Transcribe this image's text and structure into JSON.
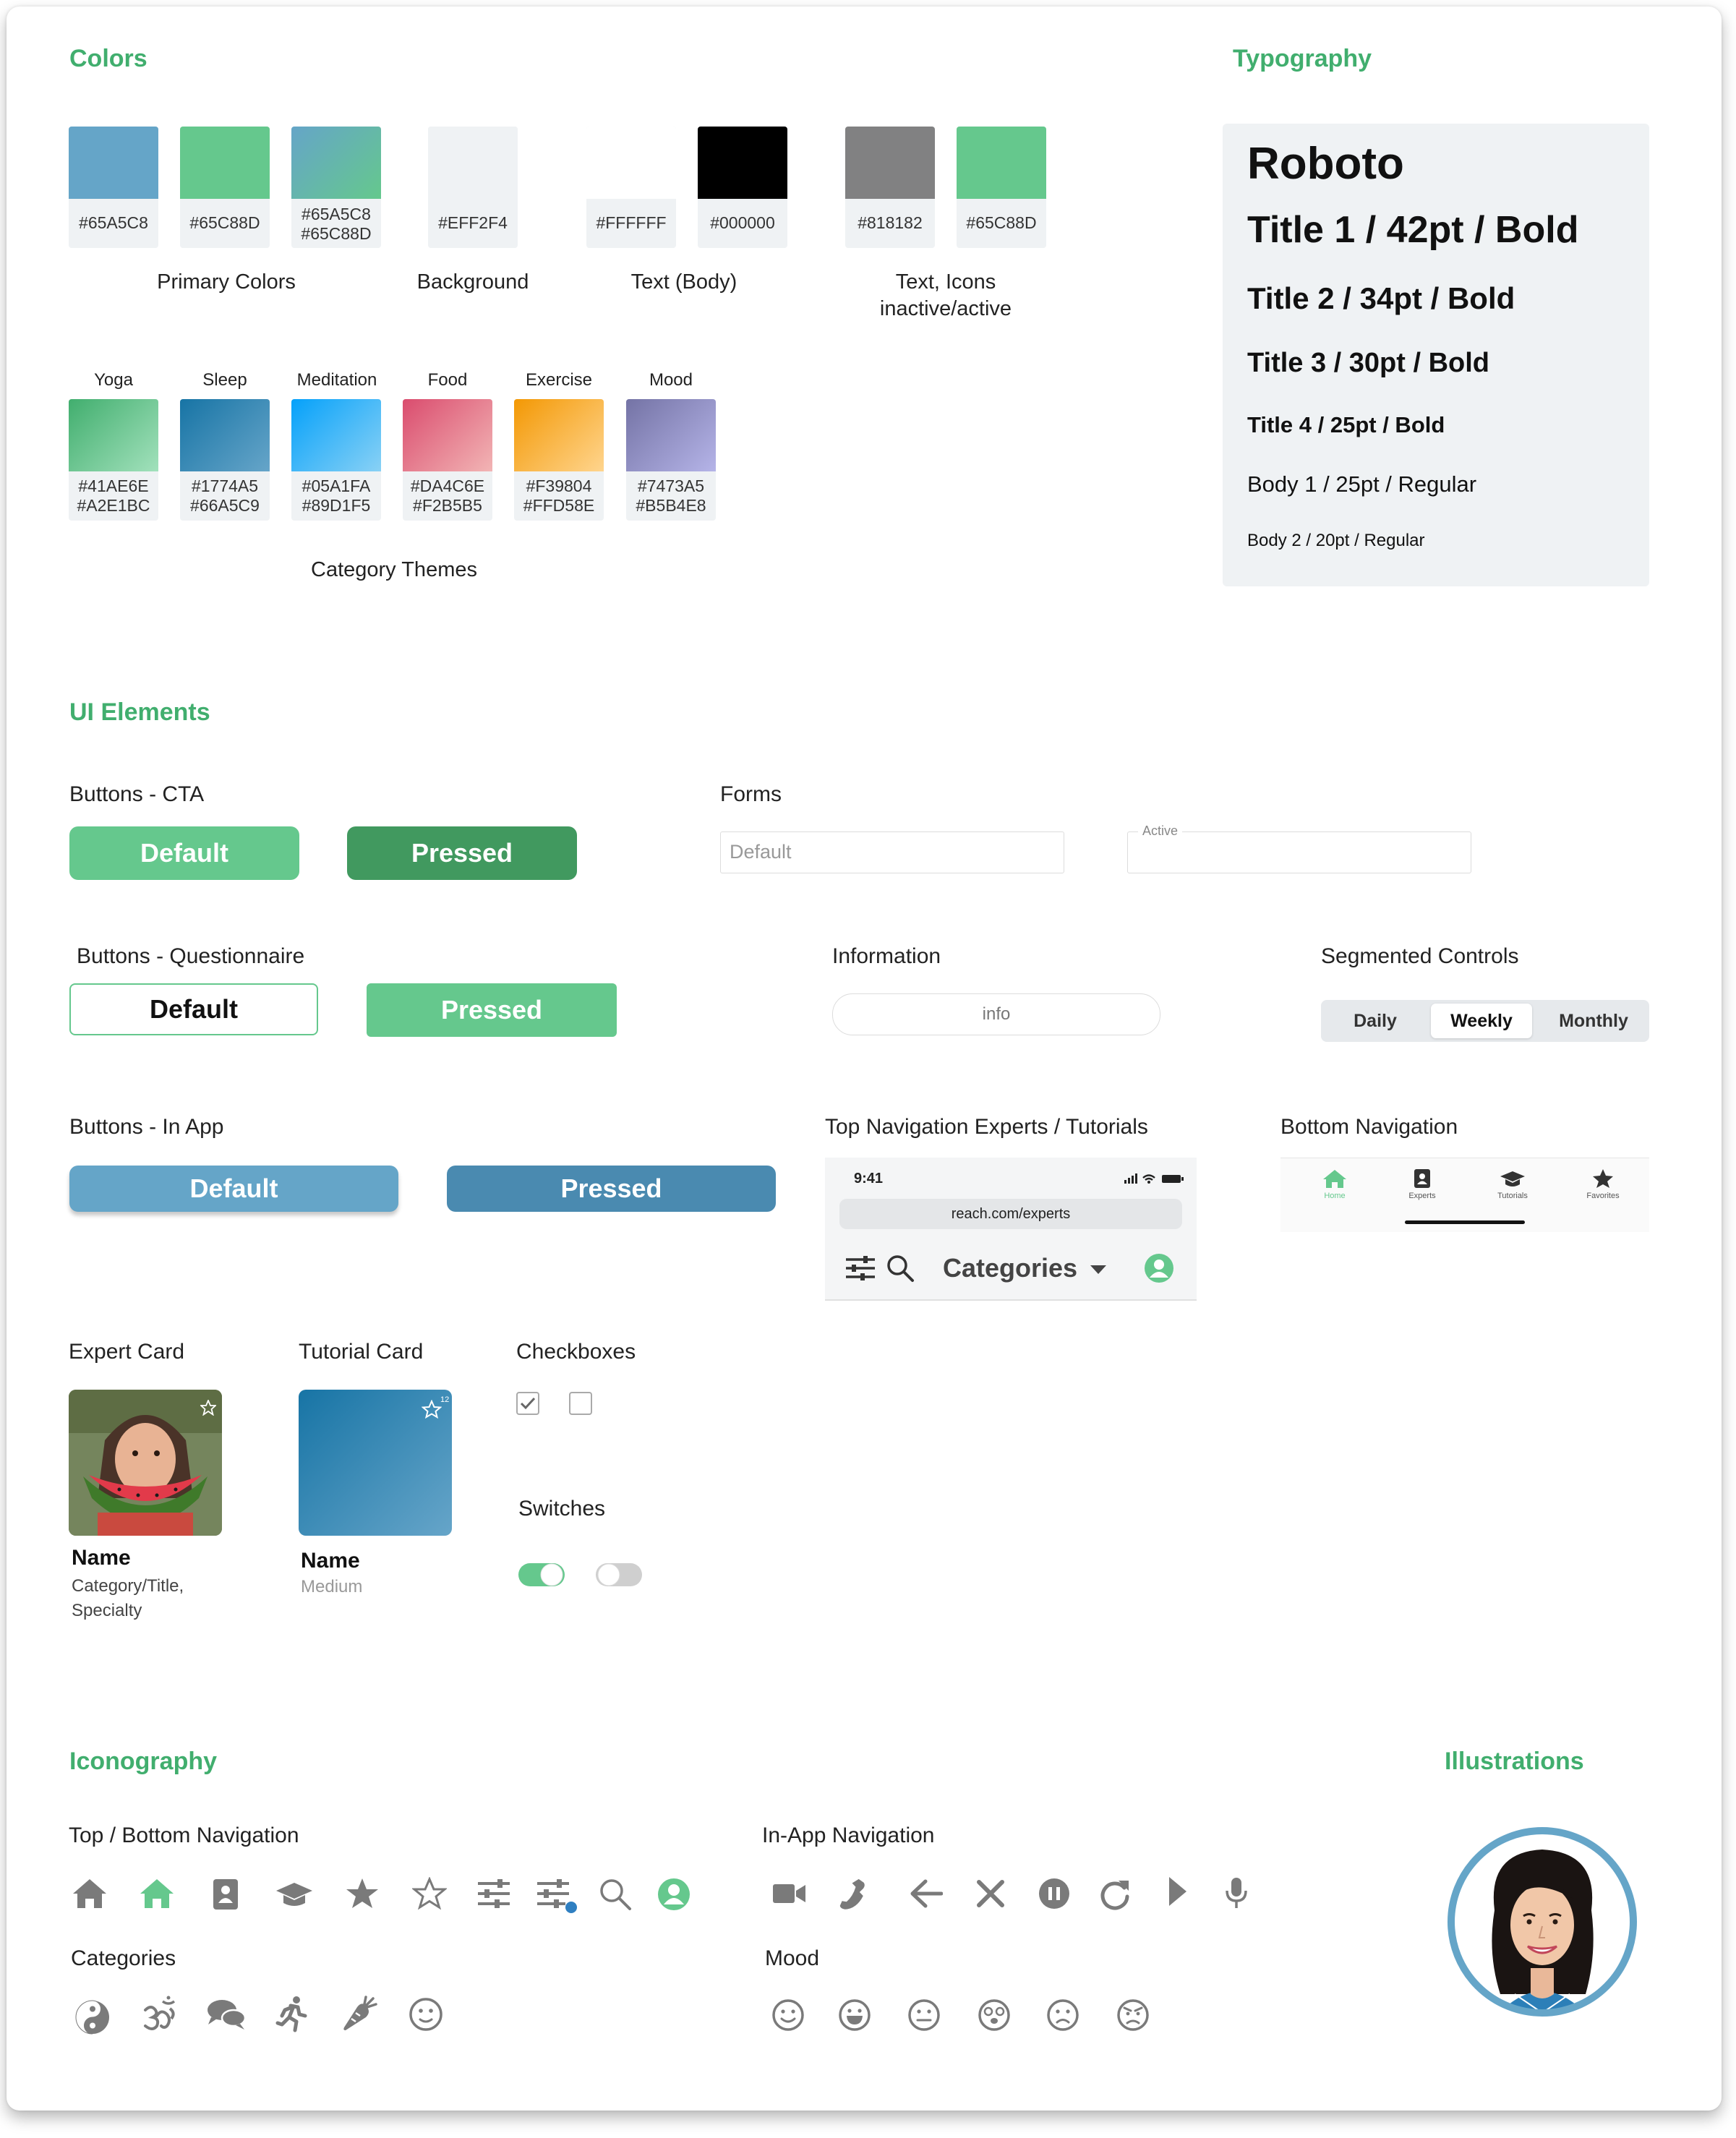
{
  "colors": {
    "title": "Colors",
    "swatches": [
      {
        "hex": "#65A5C8",
        "fill": "#65A5C8"
      },
      {
        "hex": "#65C88D",
        "fill": "#65C88D"
      },
      {
        "hex1": "#65A5C8",
        "hex2": "#65C88D"
      },
      {
        "hex": "#EFF2F4",
        "fill": "#EFF2F4"
      },
      {
        "hex": "#FFFFFF",
        "fill": "#FFFFFF"
      },
      {
        "hex": "#000000",
        "fill": "#000000"
      },
      {
        "hex": "#818182",
        "fill": "#818182"
      },
      {
        "hex": "#65C88D",
        "fill": "#65C88D"
      }
    ],
    "groups": {
      "primary": "Primary Colors",
      "background": "Background",
      "text": "Text (Body)",
      "icons_line1": "Text, Icons",
      "icons_line2": "inactive/active"
    },
    "categories": [
      {
        "name": "Yoga",
        "hex1": "#41AE6E",
        "hex2": "#A2E1BC"
      },
      {
        "name": "Sleep",
        "hex1": "#1774A5",
        "hex2": "#66A5C9"
      },
      {
        "name": "Meditation",
        "hex1": "#05A1FA",
        "hex2": "#89D1F5"
      },
      {
        "name": "Food",
        "hex1": "#DA4C6E",
        "hex2": "#F2B5B5"
      },
      {
        "name": "Exercise",
        "hex1": "#F39804",
        "hex2": "#FFD58E"
      },
      {
        "name": "Mood",
        "hex1": "#7473A5",
        "hex2": "#B5B4E8"
      }
    ],
    "category_themes": "Category Themes"
  },
  "typography": {
    "title": "Typography",
    "font": "Roboto",
    "t1": "Title 1 / 42pt / Bold",
    "t2": "Title 2 / 34pt / Bold",
    "t3": "Title 3 / 30pt / Bold",
    "t4": "Title 4 / 25pt / Bold",
    "b1": "Body 1 / 25pt / Regular",
    "b2": "Body 2 / 20pt / Regular"
  },
  "ui": {
    "title": "UI Elements",
    "cta": {
      "title": "Buttons - CTA",
      "default": "Default",
      "pressed": "Pressed"
    },
    "forms": {
      "title": "Forms",
      "default_placeholder": "Default",
      "active_label": "Active"
    },
    "questionnaire": {
      "title": "Buttons - Questionnaire",
      "default": "Default",
      "pressed": "Pressed"
    },
    "information": {
      "title": "Information",
      "info": "info"
    },
    "segmented": {
      "title": "Segmented Controls",
      "items": [
        "Daily",
        "Weekly",
        "Monthly"
      ],
      "selected": "Weekly"
    },
    "inapp": {
      "title": "Buttons - In App",
      "default": "Default",
      "pressed": "Pressed"
    },
    "topnav": {
      "title": "Top Navigation Experts / Tutorials",
      "time": "9:41",
      "url": "reach.com/experts",
      "categories": "Categories"
    },
    "bottomnav": {
      "title": "Bottom Navigation",
      "items": [
        "Home",
        "Experts",
        "Tutorials",
        "Favorites"
      ],
      "active": "Home"
    },
    "expert_card": {
      "title": "Expert Card",
      "name": "Name",
      "line1": "Category/Title,",
      "line2": "Specialty"
    },
    "tutorial_card": {
      "title": "Tutorial Card",
      "name": "Name",
      "sub": "Medium",
      "badge": "12"
    },
    "checkboxes": {
      "title": "Checkboxes"
    },
    "switches": {
      "title": "Switches"
    }
  },
  "iconography": {
    "title": "Iconography",
    "nav_title": "Top / Bottom Navigation",
    "inapp_title": "In-App Navigation",
    "categories_title": "Categories",
    "mood_title": "Mood",
    "nav_icons": [
      "home-icon",
      "home-active-icon",
      "expert-book-icon",
      "graduation-cap-icon",
      "star-filled-icon",
      "star-outline-icon",
      "sliders-icon",
      "sliders-badge-icon",
      "search-icon",
      "profile-active-icon"
    ],
    "inapp_icons": [
      "video-icon",
      "phone-icon",
      "back-arrow-icon",
      "close-icon",
      "pause-icon",
      "redo-icon",
      "play-icon",
      "microphone-icon"
    ],
    "category_icons": [
      "yin-yang-icon",
      "om-icon",
      "chat-icon",
      "runner-icon",
      "carrot-icon",
      "smiley-icon"
    ],
    "mood_icons": [
      "smile-icon",
      "grin-icon",
      "neutral-icon",
      "dizzy-icon",
      "sad-icon",
      "angry-icon"
    ]
  },
  "illustrations": {
    "title": "Illustrations"
  },
  "theme": {
    "accent": "#41AE6E",
    "green": "#65C88D",
    "blue": "#65A5C8",
    "gray": "#818182",
    "bg": "#EFF2F4"
  }
}
